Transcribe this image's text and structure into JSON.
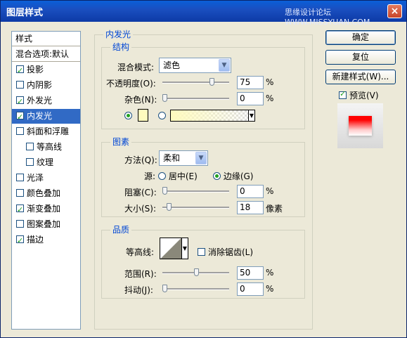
{
  "window": {
    "title": "图层样式",
    "watermark": "思缘设计论坛 WWW.MISSYUAN.COM",
    "close_label": "×"
  },
  "styles_panel": {
    "header": "样式",
    "blend_options": "混合选项:默认",
    "items": [
      {
        "label": "投影",
        "checked": true,
        "selected": false,
        "indent": false
      },
      {
        "label": "内阴影",
        "checked": false,
        "selected": false,
        "indent": false
      },
      {
        "label": "外发光",
        "checked": true,
        "selected": false,
        "indent": false
      },
      {
        "label": "内发光",
        "checked": true,
        "selected": true,
        "indent": false
      },
      {
        "label": "斜面和浮雕",
        "checked": false,
        "selected": false,
        "indent": false
      },
      {
        "label": "等高线",
        "checked": false,
        "selected": false,
        "indent": true
      },
      {
        "label": "纹理",
        "checked": false,
        "selected": false,
        "indent": true
      },
      {
        "label": "光泽",
        "checked": false,
        "selected": false,
        "indent": false
      },
      {
        "label": "颜色叠加",
        "checked": false,
        "selected": false,
        "indent": false
      },
      {
        "label": "渐变叠加",
        "checked": true,
        "selected": false,
        "indent": false
      },
      {
        "label": "图案叠加",
        "checked": false,
        "selected": false,
        "indent": false
      },
      {
        "label": "描边",
        "checked": true,
        "selected": false,
        "indent": false
      }
    ]
  },
  "inner_glow": {
    "title": "内发光",
    "structure": {
      "title": "结构",
      "blend_mode_label": "混合模式:",
      "blend_mode_value": "滤色",
      "opacity_label": "不透明度(O):",
      "opacity_value": "75",
      "opacity_unit": "%",
      "opacity_level": 0.75,
      "noise_label": "杂色(N):",
      "noise_value": "0",
      "noise_unit": "%",
      "noise_level": 0,
      "color_mode": "solid",
      "glow_color": "#fffbbe"
    },
    "elements": {
      "title": "图素",
      "technique_label": "方法(Q):",
      "technique_value": "柔和",
      "source_label": "源:",
      "source_center": "居中(E)",
      "source_edge": "边缘(G)",
      "source_selected": "edge",
      "choke_label": "阻塞(C):",
      "choke_value": "0",
      "choke_unit": "%",
      "choke_level": 0,
      "size_label": "大小(S):",
      "size_value": "18",
      "size_unit": "像素",
      "size_level": 0.072
    },
    "quality": {
      "title": "品质",
      "contour_label": "等高线:",
      "anti_alias_label": "消除锯齿(L)",
      "anti_alias_checked": false,
      "range_label": "范围(R):",
      "range_value": "50",
      "range_unit": "%",
      "range_level": 0.5,
      "jitter_label": "抖动(J):",
      "jitter_value": "0",
      "jitter_unit": "%",
      "jitter_level": 0
    }
  },
  "buttons": {
    "ok": "确定",
    "reset": "复位",
    "new_style": "新建样式(W)...",
    "preview_label": "预览(V)",
    "preview_checked": true
  },
  "colors": {
    "accent": "#316ac5",
    "legend": "#0046d5",
    "preview_red": "#ff0000"
  }
}
